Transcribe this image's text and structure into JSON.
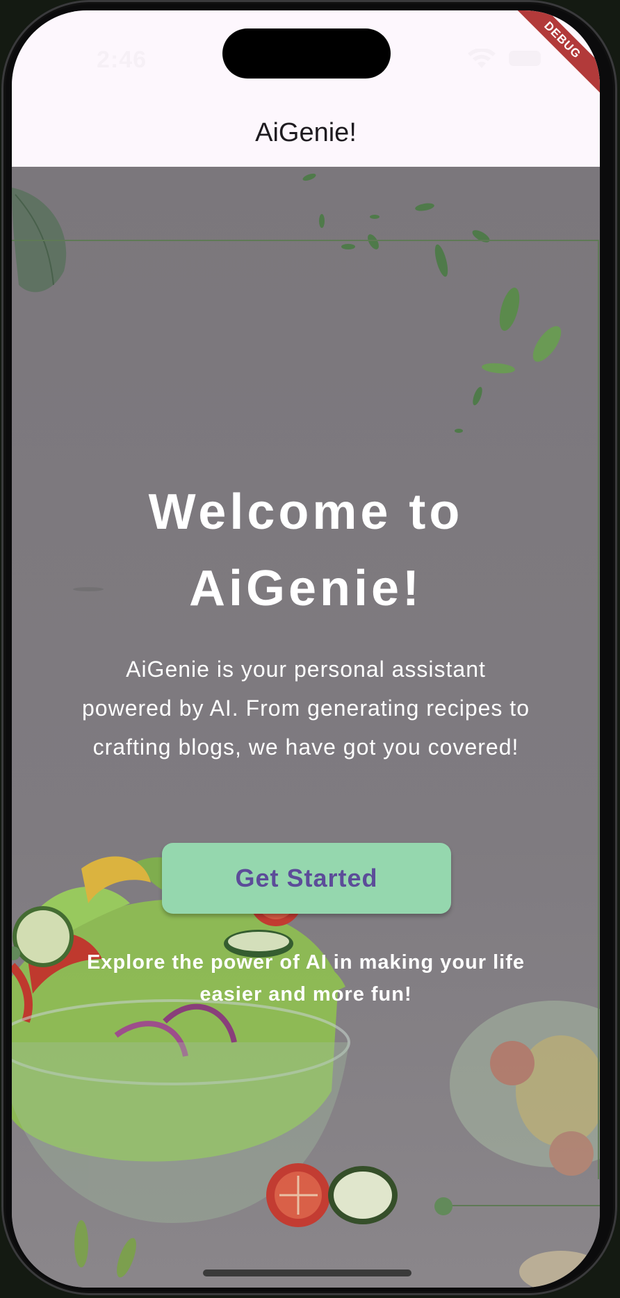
{
  "status_bar": {
    "time": "2:46",
    "debug_label": "DEBUG"
  },
  "app_bar": {
    "title": "AiGenie!"
  },
  "hero": {
    "title_line1": "Welcome to",
    "title_line2": "AiGenie!",
    "description": "AiGenie is your personal assistant powered by AI. From generating recipes to crafting blogs, we have got you covered!",
    "cta_label": "Get Started",
    "tagline": "Explore the power of AI in making your life easier and more fun!"
  },
  "colors": {
    "app_bar_bg": "#fdf7fd",
    "overlay": "#7d797e",
    "button_bg": "#95d7ae",
    "button_text": "#5c4c99",
    "debug_banner": "#b23a3a"
  },
  "icons": [
    "wifi-icon",
    "battery-icon"
  ]
}
